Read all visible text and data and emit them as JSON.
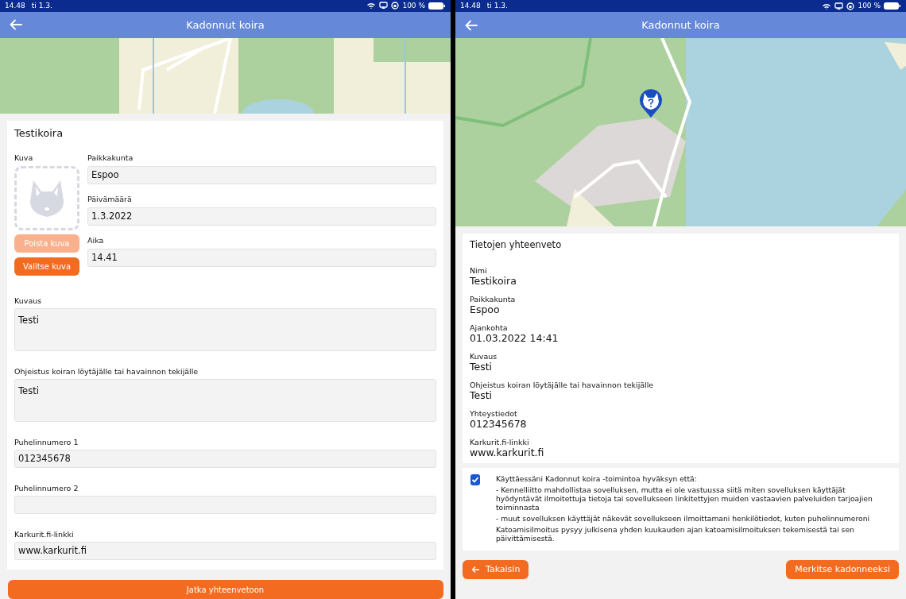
{
  "form_screen": {
    "status_bar": {
      "time": "14.48",
      "date": "ti 1.3.",
      "battery": "100 %"
    },
    "header": {
      "title": "Kadonnut koira"
    },
    "form": {
      "title": "Testikoira",
      "photo": {
        "label": "Kuva",
        "buttons": [
          {
            "label": "Poista kuva",
            "disabled": true
          },
          {
            "label": "Valitse kuva",
            "disabled": false
          }
        ]
      },
      "side_fields": [
        {
          "label": "Paikkakunta",
          "value": "Espoo"
        },
        {
          "label": "Päivämäärä",
          "value": "1.3.2022"
        },
        {
          "label": "Aika",
          "value": "14.41"
        }
      ],
      "fields": [
        {
          "kind": "textarea",
          "label": "Kuvaus",
          "value": "Testi"
        },
        {
          "kind": "textarea",
          "label": "Ohjeistus koiran löytäjälle tai havainnon tekijälle",
          "value": "Testi"
        },
        {
          "kind": "input",
          "label": "Puhelinnumero 1",
          "value": "012345678"
        },
        {
          "kind": "input",
          "label": "Puhelinnumero 2"
        },
        {
          "kind": "input",
          "label": "Karkurit.fi-linkki",
          "value": "www.karkurit.fi"
        }
      ]
    },
    "continue_button": "Jatka yhteenvetoon"
  },
  "summary_screen": {
    "status_bar": {
      "time": "14.48",
      "date": "ti 1.3.",
      "battery": "100 %"
    },
    "header": {
      "title": "Kadonnut koira"
    },
    "summary": {
      "title": "Tietojen yhteenveto",
      "items": [
        {
          "label": "Nimi",
          "value": "Testikoira"
        },
        {
          "label": "Paikkakunta",
          "value": "Espoo"
        },
        {
          "label": "Ajankohta",
          "value": "01.03.2022 14:41"
        },
        {
          "label": "Kuvaus",
          "value": "Testi"
        },
        {
          "label": "Ohjeistus koiran löytäjälle tai havainnon tekijälle",
          "value": "Testi"
        },
        {
          "label": "Yhteystiedot",
          "value": "012345678"
        },
        {
          "label": "Karkurit.fi-linkki",
          "value": "www.karkurit.fi"
        }
      ]
    },
    "consent": {
      "checked": true,
      "lines": [
        "Käyttäessäni Kadonnut koira -toimintoa hyväksyn että:",
        "- Kennelliitto mahdollistaa sovelluksen, mutta ei ole vastuussa siitä miten sovelluksen käyttäjät hyödyntävät ilmoitettuja tietoja tai sovellukseen linkitettyjen muiden vastaavien palveluiden tarjoajien toiminnasta",
        "- muut sovelluksen käyttäjät näkevät sovellukseen ilmoittamani henkilötiedot, kuten puhelinnumeroni",
        "Katoamisilmoitus pysyy julkisena yhden kuukauden ajan katoamisilmoituksen tekemisestä tai sen päivittämisestä."
      ]
    },
    "back_button": "Takaisin",
    "submit_button": "Merkitse kadonneeksi"
  }
}
